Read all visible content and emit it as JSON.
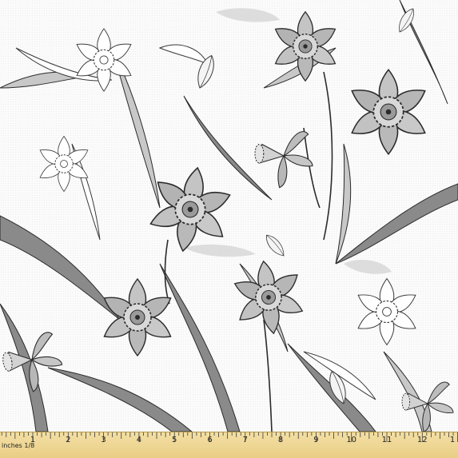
{
  "image": {
    "subject": "Daffodil fabric print",
    "colors": {
      "background": "#fbfbfb",
      "ink": "#2b2b2b",
      "petal_gray": "#bdbdbd",
      "leaf_gray": "#7a7a7a",
      "ruler": "#ecd28d"
    }
  },
  "ruler": {
    "unit_label": "inches 1/8",
    "numbers": [
      "1",
      "2",
      "3",
      "4",
      "5",
      "6",
      "7",
      "8",
      "9",
      "10",
      "11",
      "12",
      "1"
    ]
  }
}
